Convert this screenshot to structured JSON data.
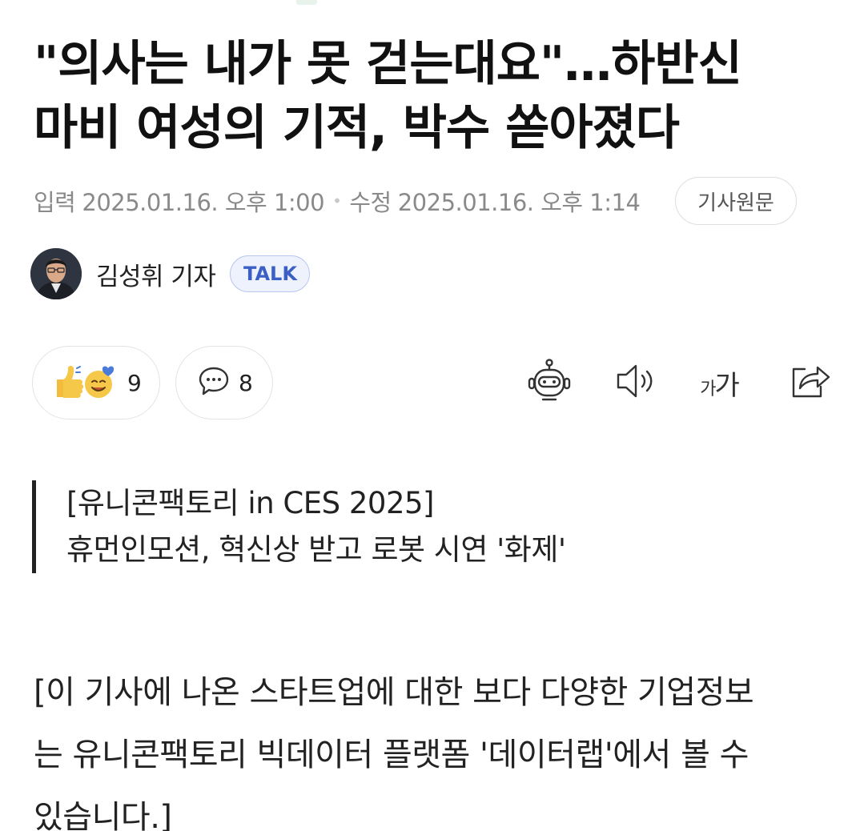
{
  "article": {
    "title_line1": "\"의사는 내가 못 걷는대요\"…하반신",
    "title_line2": "마비 여성의 기적, 박수 쏟아졌다"
  },
  "meta": {
    "input_label": "입력",
    "input_time": "2025.01.16. 오후 1:00",
    "separator": "•",
    "edit_label": "수정",
    "edit_time": "2025.01.16. 오후 1:14",
    "original_button": "기사원문"
  },
  "author": {
    "name": "김성휘 기자",
    "badge": "TALK"
  },
  "actions": {
    "reaction_count": "9",
    "comment_count": "8",
    "font_small": "가",
    "font_large": "가",
    "icons": [
      "reaction-emoji-icon",
      "comment-icon",
      "robot-summary-icon",
      "speaker-icon",
      "font-size-icon",
      "share-icon"
    ]
  },
  "subheading": {
    "line1": "[유니콘팩토리 in CES 2025]",
    "line2": "휴먼인모션, 혁신상 받고 로봇 시연 '화제'"
  },
  "body": {
    "line1": "[이 기사에 나온 스타트업에 대한 보다 다양한 기업정보",
    "line2": "는 유니콘팩토리 빅데이터 플랫폼 '데이터랩'에서 볼 수",
    "line3": "있습니다.]"
  },
  "colors": {
    "talk_badge_text": "#3b5fc4",
    "talk_badge_bg": "#eef2fd",
    "meta_text": "#8a8a8a"
  }
}
